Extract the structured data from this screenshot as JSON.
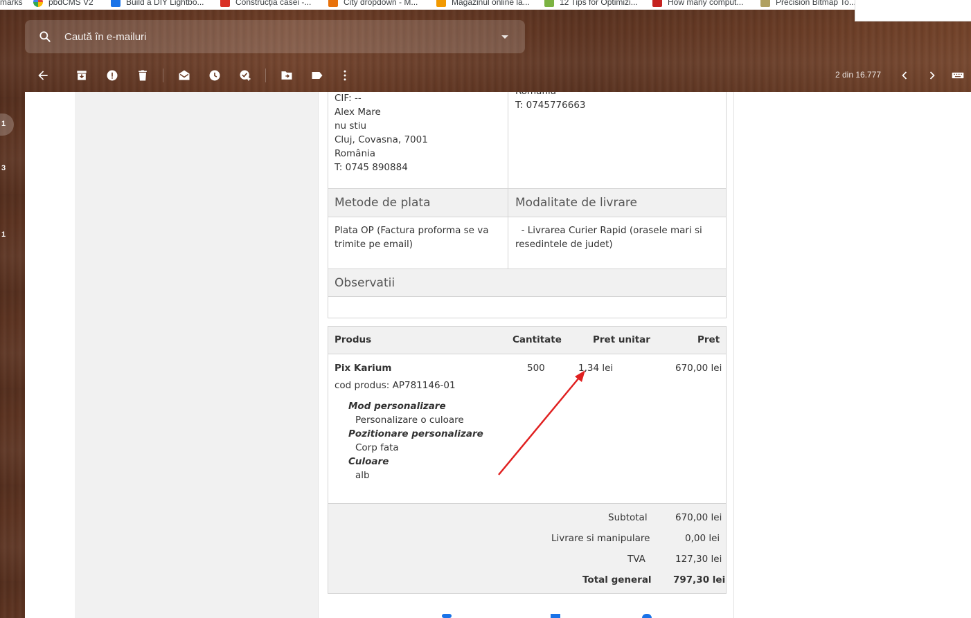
{
  "bookmarks": [
    {
      "label": "marks",
      "color": "#ffffff"
    },
    {
      "label": "pbdCMS V2",
      "color": "#4285f4"
    },
    {
      "label": "Build a DIY Lightbo...",
      "color": "#1a73e8"
    },
    {
      "label": "Construcția casei -...",
      "color": "#d93025"
    },
    {
      "label": "City dropdown - M...",
      "color": "#e8710a"
    },
    {
      "label": "Magazinul online la...",
      "color": "#f29900"
    },
    {
      "label": "12 Tips for Optimizi...",
      "color": "#7cb342"
    },
    {
      "label": "How many comput...",
      "color": "#c5221f"
    },
    {
      "label": "Precision Bitmap To...",
      "color": "#b0a060"
    }
  ],
  "search": {
    "placeholder": "Caută în e-mailuri"
  },
  "toolbar": {
    "pager": "2 din 16.777"
  },
  "side_numbers": [
    "1",
    "3",
    "1"
  ],
  "addresses": {
    "billing_lines": [
      "CIF: --",
      "Alex Mare",
      "nu stiu",
      "Cluj, Covasna, 7001",
      "România",
      "T: 0745 890884"
    ],
    "shipping_cut": "România",
    "shipping_phone": "T: 0745776663"
  },
  "payment": {
    "header": "Metode de plata",
    "value_line1": "Plata OP (Factura proforma se va",
    "value_line2": "trimite pe email)"
  },
  "delivery": {
    "header": "Modalitate de livrare",
    "value_line1": "  - Livrarea Curier Rapid (orasele mari si",
    "value_line2": "resedintele de judet)"
  },
  "observations": {
    "header": "Observatii"
  },
  "products_table": {
    "headers": {
      "product": "Produs",
      "qty": "Cantitate",
      "unit_price": "Pret unitar",
      "price": "Pret"
    },
    "item": {
      "name": "Pix Karium",
      "code": "cod produs: AP781146-01",
      "qty": "500",
      "unit_price": "1,34 lei",
      "price": "670,00 lei",
      "options": [
        {
          "label": "Mod personalizare",
          "value": "Personalizare o culoare"
        },
        {
          "label": "Pozitionare personalizare",
          "value": "Corp fata"
        },
        {
          "label": "Culoare",
          "value": "alb"
        }
      ]
    }
  },
  "totals": {
    "subtotal_label": "Subtotal",
    "subtotal": "670,00 lei",
    "shipping_label": "Livrare si manipulare",
    "shipping": "0,00 lei",
    "vat_label": "TVA",
    "vat": "127,30 lei",
    "grand_label": "Total general",
    "grand": "797,30 lei"
  },
  "colors": {
    "annotation_arrow": "#e02020",
    "header_bg": "#f1f1f1",
    "border": "#d4d4d4"
  }
}
